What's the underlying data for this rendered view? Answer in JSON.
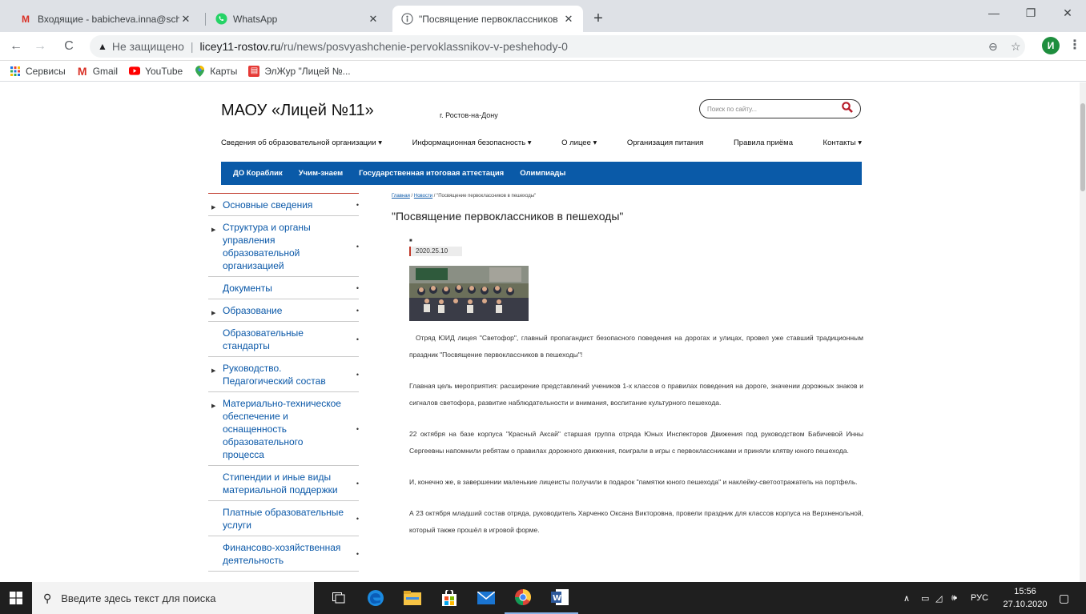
{
  "browser": {
    "tabs": [
      {
        "title": "Входящие - babicheva.inna@sch",
        "icon": "gmail-icon"
      },
      {
        "title": "WhatsApp",
        "icon": "whatsapp-icon"
      },
      {
        "title": "\"Посвящение первоклассников",
        "icon": "site-icon",
        "active": true
      }
    ],
    "omnibox": {
      "security": "Не защищено",
      "host": "licey11-rostov.ru",
      "path": "/ru/news/posvyashchenie-pervoklassnikov-v-peshehody-0"
    },
    "profile_initial": "И",
    "bookmarks": [
      {
        "label": "Сервисы",
        "icon": "apps-icon"
      },
      {
        "label": "Gmail",
        "icon": "gmail-icon"
      },
      {
        "label": "YouTube",
        "icon": "youtube-icon"
      },
      {
        "label": "Карты",
        "icon": "maps-icon"
      },
      {
        "label": "ЭлЖур \"Лицей №...",
        "icon": "eljur-icon"
      }
    ]
  },
  "site": {
    "title": "МАОУ «Лицей №11»",
    "city": "г. Ростов-на-Дону",
    "search_placeholder": "Поиск по сайту...",
    "nav": [
      "Сведения об образовательной организации ▾",
      "Информационная безопасность ▾",
      "О лицее ▾",
      "Организация питания",
      "Правила приёма",
      "Контакты ▾"
    ],
    "subnav": [
      "ДО Кораблик",
      "Учим-знаем",
      "Государственная итоговая аттестация",
      "Олимпиады"
    ],
    "sidebar": [
      {
        "label": "Основные сведения",
        "arrow": true
      },
      {
        "label": "Структура и органы управления образовательной организацией",
        "arrow": true
      },
      {
        "label": "Документы",
        "arrow": false
      },
      {
        "label": "Образование",
        "arrow": true
      },
      {
        "label": "Образовательные стандарты",
        "arrow": false
      },
      {
        "label": "Руководство. Педагогический состав",
        "arrow": true
      },
      {
        "label": "Материально-техническое обеспечение и оснащенность образовательного процесса",
        "arrow": true
      },
      {
        "label": "Стипендии и иные виды материальной поддержки",
        "arrow": false
      },
      {
        "label": "Платные образовательные услуги",
        "arrow": false
      },
      {
        "label": "Финансово-хозяйственная деятельность",
        "arrow": false
      }
    ],
    "breadcrumb": {
      "home": "Главная",
      "news": "Новости",
      "current": "\"Посвящение первоклассников в пешеходы\""
    },
    "headline": "\"Посвящение первоклассников в пешеходы\"",
    "date": "2020.25.10",
    "paragraphs": [
      "Отряд ЮИД лицея \"Светофор\", главный пропагандист безопасного поведения на дорогах и улицах, провел уже ставший традиционным праздник \"Посвящение первоклассников в пешеходы\"!",
      "Главная цель мероприятия: расширение представлений учеников 1-х классов о правилах поведения на дороге, значении дорожных знаков и сигналов светофора, развитие наблюдательности и внимания, воспитание культурного пешехода.",
      "22 октября  на базе корпуса \"Красный Аксай\" старшая группа отряда Юных Инспекторов Движения под руководством Бабичевой Инны Сергеевны напомнили ребятам о правилах дорожного движения, поиграли в игры с первоклассниками и приняли клятву юного пешехода.",
      "И, конечно же, в завершении маленькие лицеисты получили в подарок \"памятки юного пешехода\" и наклейку-светоотражатель на портфель.",
      "А 23 октября младший состав отряда, руководитель Харченко Оксана Викторовна, провели праздник для классов корпуса на Верхненольной, который также прошёл в игровой форме."
    ]
  },
  "taskbar": {
    "search_placeholder": "Введите здесь текст для поиска",
    "lang": "РУС",
    "time": "15:56",
    "date": "27.10.2020"
  }
}
